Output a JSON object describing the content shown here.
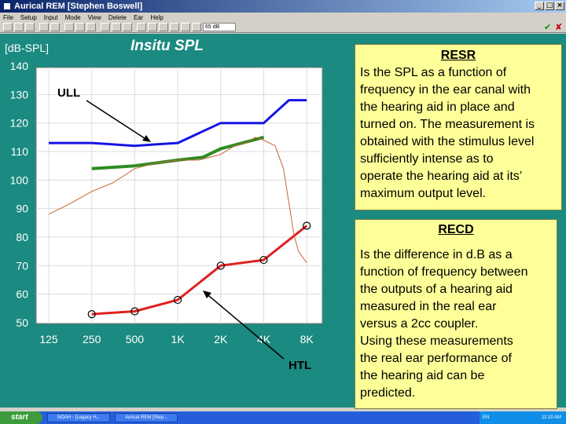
{
  "window": {
    "title": "Aurical REM [Stephen Boswell]",
    "minimize_glyph": "_",
    "maximize_glyph": "□",
    "close_glyph": "×"
  },
  "menu": [
    "File",
    "Setup",
    "Input",
    "Mode",
    "View",
    "Delete",
    "Ear",
    "Help"
  ],
  "toolbar": {
    "level_select": "65 dB",
    "confirm_glyph": "✔",
    "cancel_glyph": "✘"
  },
  "graph": {
    "unit_label": "[dB-SPL]",
    "title": "Insitu SPL",
    "y_ticks": [
      "140",
      "130",
      "120",
      "110",
      "100",
      "90",
      "80",
      "70",
      "60",
      "50"
    ],
    "x_ticks": [
      "125",
      "250",
      "500",
      "1K",
      "2K",
      "4K",
      "8K"
    ]
  },
  "chart_data": {
    "type": "line",
    "title": "Insitu SPL",
    "ylabel": "[dB-SPL]",
    "xlabel": "",
    "x_scale": "log",
    "ylim": [
      50,
      140
    ],
    "x_categories": [
      "125",
      "250",
      "500",
      "1K",
      "2K",
      "4K",
      "8K"
    ],
    "grid": true,
    "series": [
      {
        "name": "ULL",
        "color": "#1414e6",
        "x": [
          125,
          250,
          500,
          700,
          1000,
          2000,
          4000,
          6000,
          8000
        ],
        "y": [
          113,
          113,
          112,
          112.5,
          113,
          120,
          120,
          128,
          128
        ]
      },
      {
        "name": "",
        "color": "#2e8b22",
        "x": [
          250,
          500,
          1000,
          1500,
          2000,
          4000
        ],
        "y": [
          104,
          105,
          107,
          108,
          111,
          115
        ]
      },
      {
        "name": "HTL",
        "color": "#e02020",
        "markers": "circle",
        "x": [
          250,
          500,
          1000,
          2000,
          4000,
          8000
        ],
        "y": [
          53,
          54,
          58,
          70,
          72,
          84
        ]
      },
      {
        "name": "",
        "color": "#c86432",
        "x": [
          125,
          180,
          250,
          350,
          500,
          700,
          1000,
          1400,
          2000,
          2500,
          3000,
          3500,
          4000,
          4800,
          5500,
          6000,
          6500,
          7000,
          8000
        ],
        "y": [
          88,
          92,
          96,
          99,
          104,
          106,
          107,
          107,
          109,
          112,
          113,
          115,
          114,
          112,
          104,
          92,
          81,
          75,
          71
        ]
      }
    ],
    "annotations": [
      "ULL",
      "HTL"
    ]
  },
  "annotations": {
    "ull": "ULL",
    "htl": "HTL"
  },
  "resr": {
    "title": "RESR",
    "lines": [
      "Is the SPL as a function of",
      "frequency in the ear canal with",
      "the hearing aid in place and",
      "turned on. The measurement is",
      "obtained with the stimulus level",
      "sufficiently intense as to",
      "operate the hearing aid at its’",
      "maximum output level."
    ]
  },
  "recd": {
    "title": "RECD",
    "lines": [
      "Is the difference in d.B as a",
      "function of frequency between",
      "the outputs of a hearing aid",
      "measured in the real ear",
      "versus a 2cc coupler.",
      "Using these measurements",
      "the real ear performance of",
      "the hearing aid can be",
      "predicted."
    ]
  },
  "taskbar": {
    "start": "start",
    "tasks": [
      "NOAH - [Legacy H...",
      "Aurical REM [Step..."
    ],
    "tray_lang": "EN",
    "clock": "11:10 AM"
  }
}
